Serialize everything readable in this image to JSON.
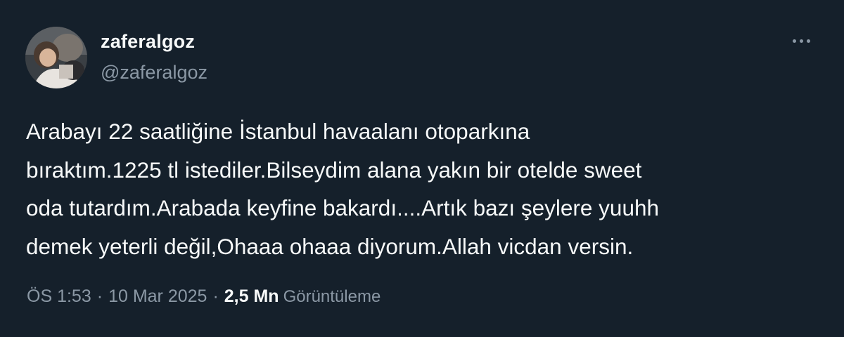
{
  "author": {
    "display_name": "zaferalgoz",
    "handle": "@zaferalgoz",
    "avatar_icon": "avatar-photo"
  },
  "more_icon": "more-horizontal-icon",
  "tweet": {
    "lines": [
      "Arabayı 22 saatliğine İstanbul havaalanı otoparkına",
      "bıraktım.1225 tl istediler.Bilseydim alana yakın bir otelde sweet",
      "oda tutardım.Arabada keyfine bakardı....Artık bazı şeylere yuuhh",
      "demek yeterli değil,Ohaaa ohaaa diyorum.Allah vicdan versin."
    ]
  },
  "meta": {
    "time": "ÖS 1:53",
    "separator": "·",
    "date": "10 Mar 2025",
    "views_count": "2,5 Mn",
    "views_label": "Görüntüleme"
  },
  "colors": {
    "background": "#15202b",
    "primary_text": "#f7f9f9",
    "secondary_text": "#8b98a5"
  }
}
